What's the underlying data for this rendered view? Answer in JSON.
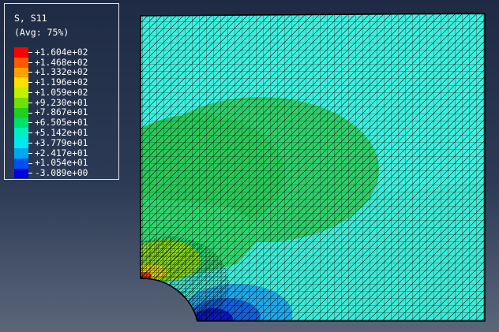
{
  "legend": {
    "title": "S, S11",
    "subtitle": "(Avg: 75%)",
    "levels": [
      {
        "label": "+1.604e+02",
        "color": "#ff0000"
      },
      {
        "label": "+1.468e+02",
        "color": "#ff5a00"
      },
      {
        "label": "+1.332e+02",
        "color": "#ffa000"
      },
      {
        "label": "+1.196e+02",
        "color": "#ffe000"
      },
      {
        "label": "+1.059e+02",
        "color": "#c0f000"
      },
      {
        "label": "+9.230e+01",
        "color": "#70e000"
      },
      {
        "label": "+7.867e+01",
        "color": "#20d020"
      },
      {
        "label": "+6.505e+01",
        "color": "#00e070"
      },
      {
        "label": "+5.142e+01",
        "color": "#00f0c0"
      },
      {
        "label": "+3.779e+01",
        "color": "#00e8f0"
      },
      {
        "label": "+2.417e+01",
        "color": "#00a8f0"
      },
      {
        "label": "+1.054e+01",
        "color": "#0050f0"
      },
      {
        "label": "-3.089e+00",
        "color": "#0000e0"
      }
    ]
  },
  "model": {
    "background_color": "#40e8d0",
    "mesh_line_color": "#000000"
  }
}
